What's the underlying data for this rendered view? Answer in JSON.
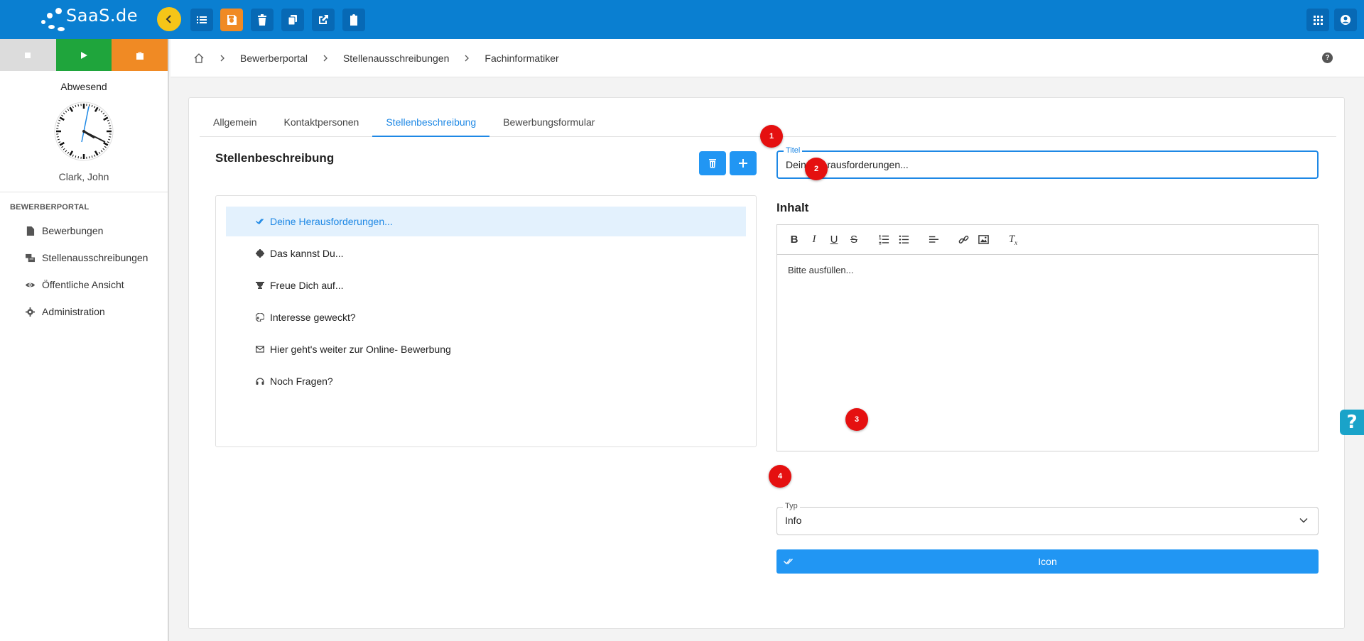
{
  "app": {
    "logo_text": "SaaS.de"
  },
  "toolbar": {
    "buttons": [
      "list-icon",
      "save-icon",
      "trash-icon",
      "copy-icon",
      "external-link-icon",
      "clipboard-icon"
    ],
    "right_buttons": [
      "apps-grid-icon",
      "user-icon"
    ],
    "colors": {
      "bar": "#0a7fd1",
      "save": "#f08a24",
      "collapse": "#f5c518"
    }
  },
  "sidebar": {
    "status_buttons": [
      "stop-icon",
      "play-icon",
      "briefcase-icon"
    ],
    "presence": "Abwesend",
    "user": "Clark, John",
    "section": "BEWERBERPORTAL",
    "items": [
      {
        "label": "Bewerbungen",
        "icon": "document-icon"
      },
      {
        "label": "Stellenausschreibungen",
        "icon": "job-postings-icon"
      },
      {
        "label": "Öffentliche Ansicht",
        "icon": "eye-icon"
      },
      {
        "label": "Administration",
        "icon": "gear-icon"
      }
    ]
  },
  "breadcrumb": {
    "items": [
      "Bewerberportal",
      "Stellenausschreibungen",
      "Fachinformatiker"
    ],
    "help": "?"
  },
  "tabs": [
    "Allgemein",
    "Kontaktpersonen",
    "Stellenbeschreibung",
    "Bewerbungsformular"
  ],
  "list": {
    "title": "Stellenbeschreibung",
    "items": [
      {
        "label": "Deine Herausforderungen...",
        "icon": "double-check-icon",
        "selected": true
      },
      {
        "label": "Das kannst Du...",
        "icon": "badge-icon"
      },
      {
        "label": "Freue Dich auf...",
        "icon": "trophy-icon"
      },
      {
        "label": "Interesse geweckt?",
        "icon": "palette-icon"
      },
      {
        "label": "Hier geht's weiter zur Online- Bewerbung",
        "icon": "envelope-icon"
      },
      {
        "label": "Noch Fragen?",
        "icon": "headset-icon"
      }
    ]
  },
  "form": {
    "title_label": "Titel",
    "title_value": "Deine Herausforderungen...",
    "content_label": "Inhalt",
    "content_text": "Bitte ausfüllen...",
    "type_label": "Typ",
    "type_value": "Info",
    "icon_button": "Icon"
  },
  "markers": [
    "1",
    "2",
    "3",
    "4"
  ],
  "help_tab": "?"
}
